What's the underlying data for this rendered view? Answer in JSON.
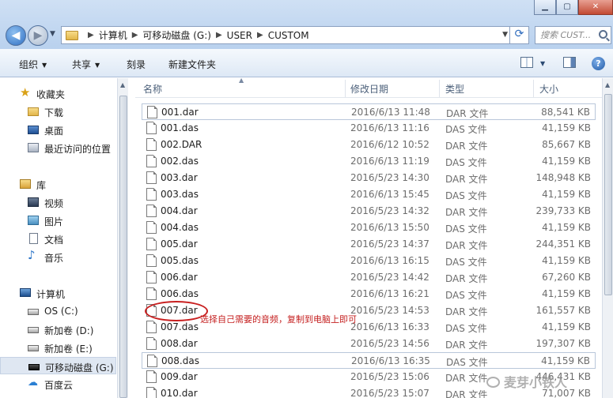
{
  "window": {
    "minimize_glyph": "▁",
    "maximize_glyph": "▢",
    "close_glyph": "✕"
  },
  "address": {
    "breadcrumbs": [
      "计算机",
      "可移动磁盘 (G:)",
      "USER",
      "CUSTOM"
    ],
    "search_placeholder": "搜索 CUST..."
  },
  "toolbar": {
    "organize": "组织",
    "share": "共享",
    "burn": "刻录",
    "new_folder": "新建文件夹",
    "help_glyph": "?"
  },
  "nav": {
    "favorites": "收藏夹",
    "downloads": "下载",
    "desktop": "桌面",
    "recent": "最近访问的位置",
    "libraries": "库",
    "videos": "视频",
    "pictures": "图片",
    "documents": "文档",
    "music": "音乐",
    "computer": "计算机",
    "drive_c": "OS (C:)",
    "drive_d": "新加卷 (D:)",
    "drive_e": "新加卷 (E:)",
    "drive_g": "可移动磁盘 (G:)",
    "baidu": "百度云"
  },
  "columns": {
    "name": "名称",
    "date": "修改日期",
    "type": "类型",
    "size": "大小"
  },
  "files": [
    {
      "name": "001.dar",
      "date": "2016/6/13 11:48",
      "type": "DAR 文件",
      "size": "88,541 KB"
    },
    {
      "name": "001.das",
      "date": "2016/6/13 11:16",
      "type": "DAS 文件",
      "size": "41,159 KB"
    },
    {
      "name": "002.DAR",
      "date": "2016/6/12 10:52",
      "type": "DAR 文件",
      "size": "85,667 KB"
    },
    {
      "name": "002.das",
      "date": "2016/6/13 11:19",
      "type": "DAS 文件",
      "size": "41,159 KB"
    },
    {
      "name": "003.dar",
      "date": "2016/5/23 14:30",
      "type": "DAR 文件",
      "size": "148,948 KB"
    },
    {
      "name": "003.das",
      "date": "2016/6/13 15:45",
      "type": "DAS 文件",
      "size": "41,159 KB"
    },
    {
      "name": "004.dar",
      "date": "2016/5/23 14:32",
      "type": "DAR 文件",
      "size": "239,733 KB"
    },
    {
      "name": "004.das",
      "date": "2016/6/13 15:50",
      "type": "DAS 文件",
      "size": "41,159 KB"
    },
    {
      "name": "005.dar",
      "date": "2016/5/23 14:37",
      "type": "DAR 文件",
      "size": "244,351 KB"
    },
    {
      "name": "005.das",
      "date": "2016/6/13 16:15",
      "type": "DAS 文件",
      "size": "41,159 KB"
    },
    {
      "name": "006.dar",
      "date": "2016/5/23 14:42",
      "type": "DAR 文件",
      "size": "67,260 KB"
    },
    {
      "name": "006.das",
      "date": "2016/6/13 16:21",
      "type": "DAS 文件",
      "size": "41,159 KB"
    },
    {
      "name": "007.dar",
      "date": "2016/5/23 14:53",
      "type": "DAR 文件",
      "size": "161,557 KB"
    },
    {
      "name": "007.das",
      "date": "2016/6/13 16:33",
      "type": "DAS 文件",
      "size": "41,159 KB"
    },
    {
      "name": "008.dar",
      "date": "2016/5/23 14:56",
      "type": "DAR 文件",
      "size": "197,307 KB"
    },
    {
      "name": "008.das",
      "date": "2016/6/13 16:35",
      "type": "DAS 文件",
      "size": "41,159 KB"
    },
    {
      "name": "009.dar",
      "date": "2016/5/23 15:06",
      "type": "DAR 文件",
      "size": "446,431 KB"
    },
    {
      "name": "010.dar",
      "date": "2016/5/23 15:07",
      "type": "DAR 文件",
      "size": "71,007 KB"
    }
  ],
  "annotation": {
    "note": "选择自己需要的音频，复制到电脑上即可"
  },
  "watermark": {
    "text": "麦芽小铁人"
  }
}
